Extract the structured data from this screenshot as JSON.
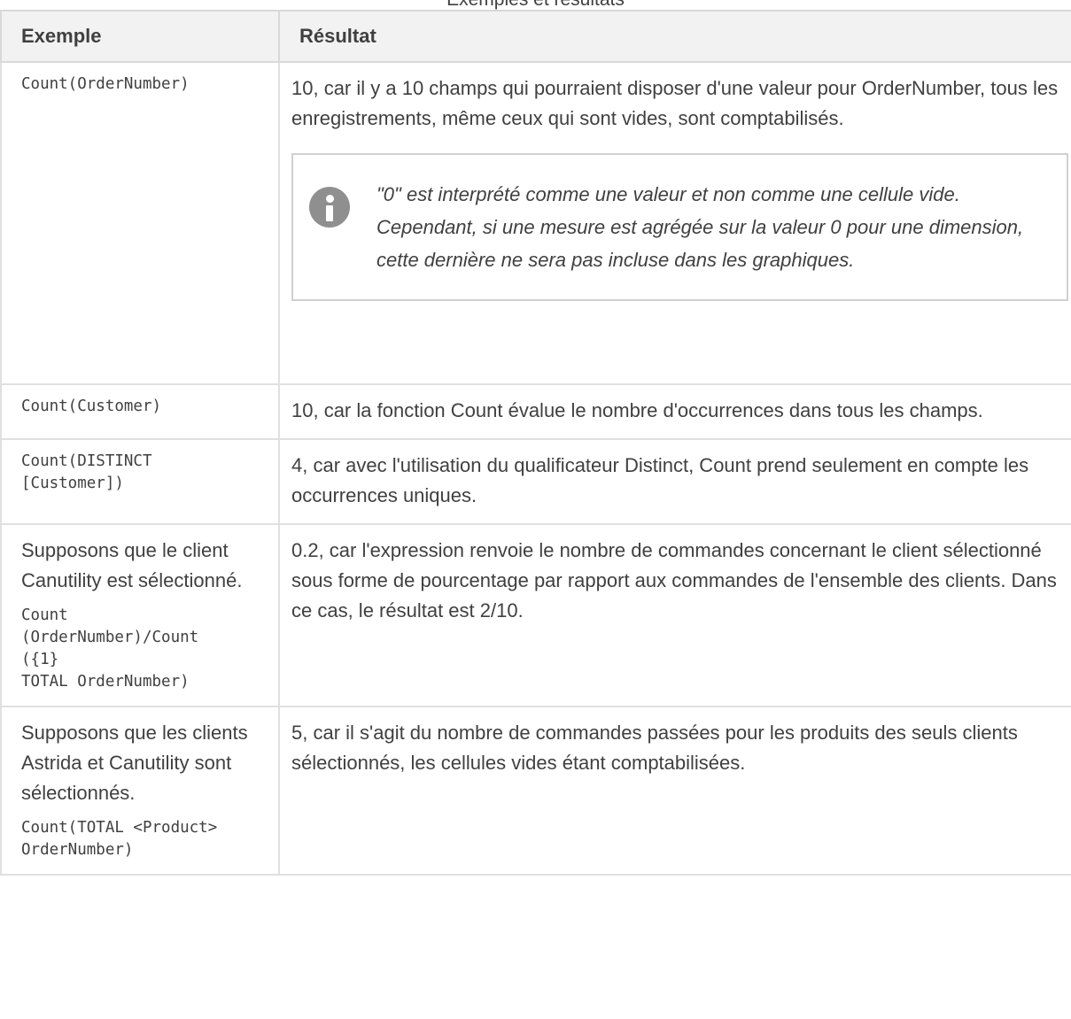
{
  "caption": "Exemples et résultats",
  "table": {
    "headers": [
      "Exemple",
      "Résultat"
    ],
    "rows": [
      {
        "code": "Count(OrderNumber)",
        "result": "10, car il y a 10 champs qui pourraient disposer d'une valeur pour OrderNumber, tous les enregistrements, même ceux qui sont vides, sont comptabilisés.",
        "note": "\"0\" est interprété comme une valeur et non comme une cellule vide. Cependant, si une mesure est agrégée sur la valeur 0 pour une dimension, cette dernière ne sera pas incluse dans les graphiques.",
        "note_icon": "info-icon"
      },
      {
        "code": "Count(Customer)",
        "result": "10, car la fonction Count évalue le nombre d'occurrences dans tous les champs."
      },
      {
        "code": "Count(DISTINCT\n[Customer])",
        "result": "4, car avec l'utilisation du qualificateur Distinct, Count prend seulement en compte les occurrences uniques."
      },
      {
        "text": "Supposons que le client Canutility est sélectionné.",
        "code": "Count\n(OrderNumber)/Count\n({1}\nTOTAL OrderNumber)",
        "result": "0.2, car l'expression renvoie le nombre de commandes concernant le client sélectionné sous forme de pourcentage par rapport aux commandes de l'ensemble des clients. Dans ce cas, le résultat est 2/10."
      },
      {
        "text": "Supposons que les clients Astrida et Canutility sont sélectionnés.",
        "code": "Count(TOTAL <Product>\nOrderNumber)",
        "result": "5, car il s'agit du nombre de commandes passées pour les produits des seuls clients sélectionnés, les cellules vides étant comptabilisées."
      }
    ]
  }
}
